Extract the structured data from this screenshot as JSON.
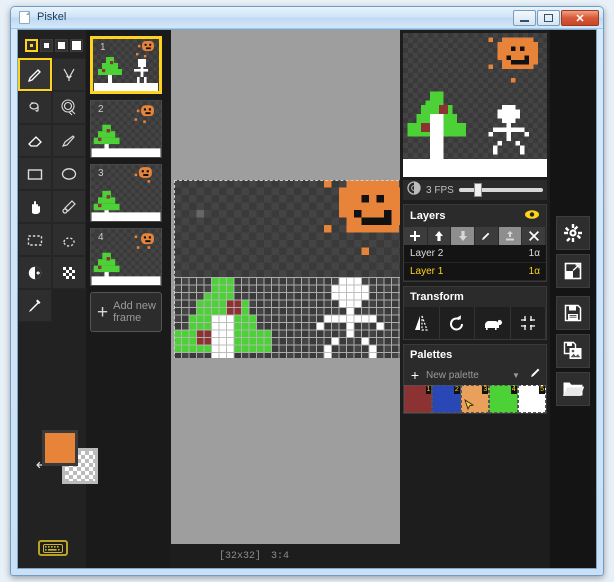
{
  "window": {
    "title": "Piskel",
    "doc_icon": "document-icon",
    "minimize_label": "─",
    "maximize_label": "□",
    "close_label": "✕"
  },
  "toolbar": {
    "pen_sizes": [
      {
        "name": "pen-size-1",
        "selected": true
      },
      {
        "name": "pen-size-2",
        "selected": false
      },
      {
        "name": "pen-size-3",
        "selected": false
      },
      {
        "name": "pen-size-4",
        "selected": false
      }
    ],
    "tools": [
      {
        "name": "pencil-tool",
        "selected": true
      },
      {
        "name": "vertical-mirror-pen-tool",
        "selected": false
      },
      {
        "name": "paint-bucket-tool",
        "selected": false
      },
      {
        "name": "paint-all-similar-pixels-tool",
        "selected": false
      },
      {
        "name": "eraser-tool",
        "selected": false
      },
      {
        "name": "stroke-tool",
        "selected": false
      },
      {
        "name": "rectangle-tool",
        "selected": false
      },
      {
        "name": "circle-tool",
        "selected": false
      },
      {
        "name": "move-tool",
        "selected": false
      },
      {
        "name": "shape-selection-tool",
        "selected": false
      },
      {
        "name": "rectangle-select-tool",
        "selected": false
      },
      {
        "name": "lasso-select-tool",
        "selected": false
      },
      {
        "name": "lighten-tool",
        "selected": false
      },
      {
        "name": "dithering-tool",
        "selected": false
      },
      {
        "name": "color-picker-tool",
        "selected": false
      }
    ],
    "primary_color": "#e8833a",
    "secondary_color": "transparent",
    "swap_icon": "swap-colors-arrow-icon",
    "keyboard_shortcuts_icon": "keyboard-icon"
  },
  "frames": {
    "items": [
      {
        "number": "1",
        "selected": true
      },
      {
        "number": "2",
        "selected": false
      },
      {
        "number": "3",
        "selected": false
      },
      {
        "number": "4",
        "selected": false
      }
    ],
    "add_frame_label": "Add new frame",
    "add_icon": "plus-icon"
  },
  "canvas": {
    "size_label": "[32x32]",
    "zoom_label": "3:4"
  },
  "preview": {
    "onion_skin_icon": "onion-skin-icon",
    "fps_label": "3 FPS",
    "fps_value": 3,
    "slider_position_pct": 18
  },
  "layers": {
    "title": "Layers",
    "visibility_icon": "eye-icon",
    "buttons": [
      {
        "name": "add-layer-button",
        "icon": "plus-icon",
        "disabled": false
      },
      {
        "name": "move-layer-up-button",
        "icon": "arrow-up-icon",
        "disabled": false
      },
      {
        "name": "move-layer-down-button",
        "icon": "arrow-down-icon",
        "disabled": true
      },
      {
        "name": "rename-layer-button",
        "icon": "pencil-icon",
        "disabled": false
      },
      {
        "name": "merge-layer-button",
        "icon": "merge-down-icon",
        "disabled": true
      },
      {
        "name": "delete-layer-button",
        "icon": "close-x-icon",
        "disabled": false
      }
    ],
    "items": [
      {
        "name": "Layer 2",
        "opacity": "1α",
        "selected": false
      },
      {
        "name": "Layer 1",
        "opacity": "1α",
        "selected": true
      }
    ]
  },
  "transform": {
    "title": "Transform",
    "buttons": [
      {
        "name": "flip-horizontal-button",
        "icon": "flip-icon"
      },
      {
        "name": "rotate-button",
        "icon": "rotate-ccw-icon"
      },
      {
        "name": "clone-button",
        "icon": "sheep-clone-icon"
      },
      {
        "name": "center-button",
        "icon": "center-crosshair-icon"
      }
    ]
  },
  "palettes": {
    "title": "Palettes",
    "add_icon": "plus-icon",
    "selected_palette": "New palette",
    "caret_icon": "chevron-down-icon",
    "edit_icon": "pencil-icon",
    "swatches": [
      {
        "number": "1",
        "color": "#8c3232",
        "active": false
      },
      {
        "number": "2",
        "color": "#2a47b6",
        "active": false
      },
      {
        "number": "3",
        "color": "#e8a05a",
        "active": true
      },
      {
        "number": "4",
        "color": "#4cd137",
        "active": false
      },
      {
        "number": "5",
        "color": "#ffffff",
        "active": false
      }
    ]
  },
  "rail": {
    "buttons": [
      {
        "name": "settings-button",
        "icon": "gear-icon"
      },
      {
        "name": "resize-button",
        "icon": "resize-icon"
      },
      {
        "name": "save-button",
        "icon": "floppy-disk-icon"
      },
      {
        "name": "export-button",
        "icon": "export-image-icon"
      },
      {
        "name": "open-button",
        "icon": "folder-icon"
      }
    ]
  }
}
